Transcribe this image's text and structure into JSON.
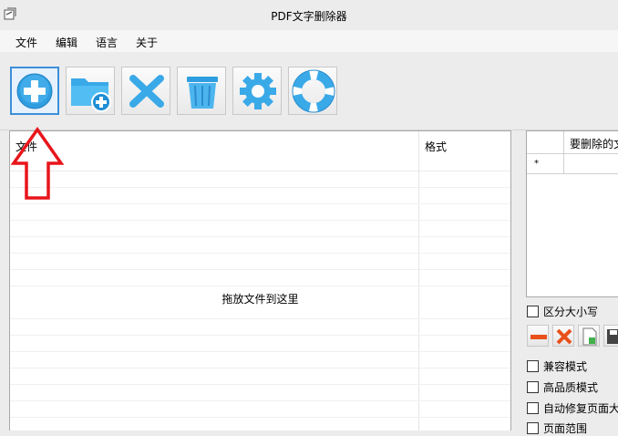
{
  "window": {
    "title": "PDF文字删除器"
  },
  "menu": {
    "items": [
      "文件",
      "编辑",
      "语言",
      "关于"
    ]
  },
  "file_list": {
    "col_file": "文件",
    "col_format": "格式",
    "drop_hint": "拖放文件到这里"
  },
  "right_table": {
    "col": "要删除的文",
    "new_row_marker": "*"
  },
  "options": {
    "case_sensitive": "区分大小写",
    "compat_mode": "兼容模式",
    "hq_mode": "高品质模式",
    "auto_fix": "自动修复页面大",
    "page_range": "页面范围"
  },
  "colors": {
    "icon_blue": "#36a8e8",
    "arrow_red": "#e8151b",
    "active_border": "#3d8fd8"
  }
}
